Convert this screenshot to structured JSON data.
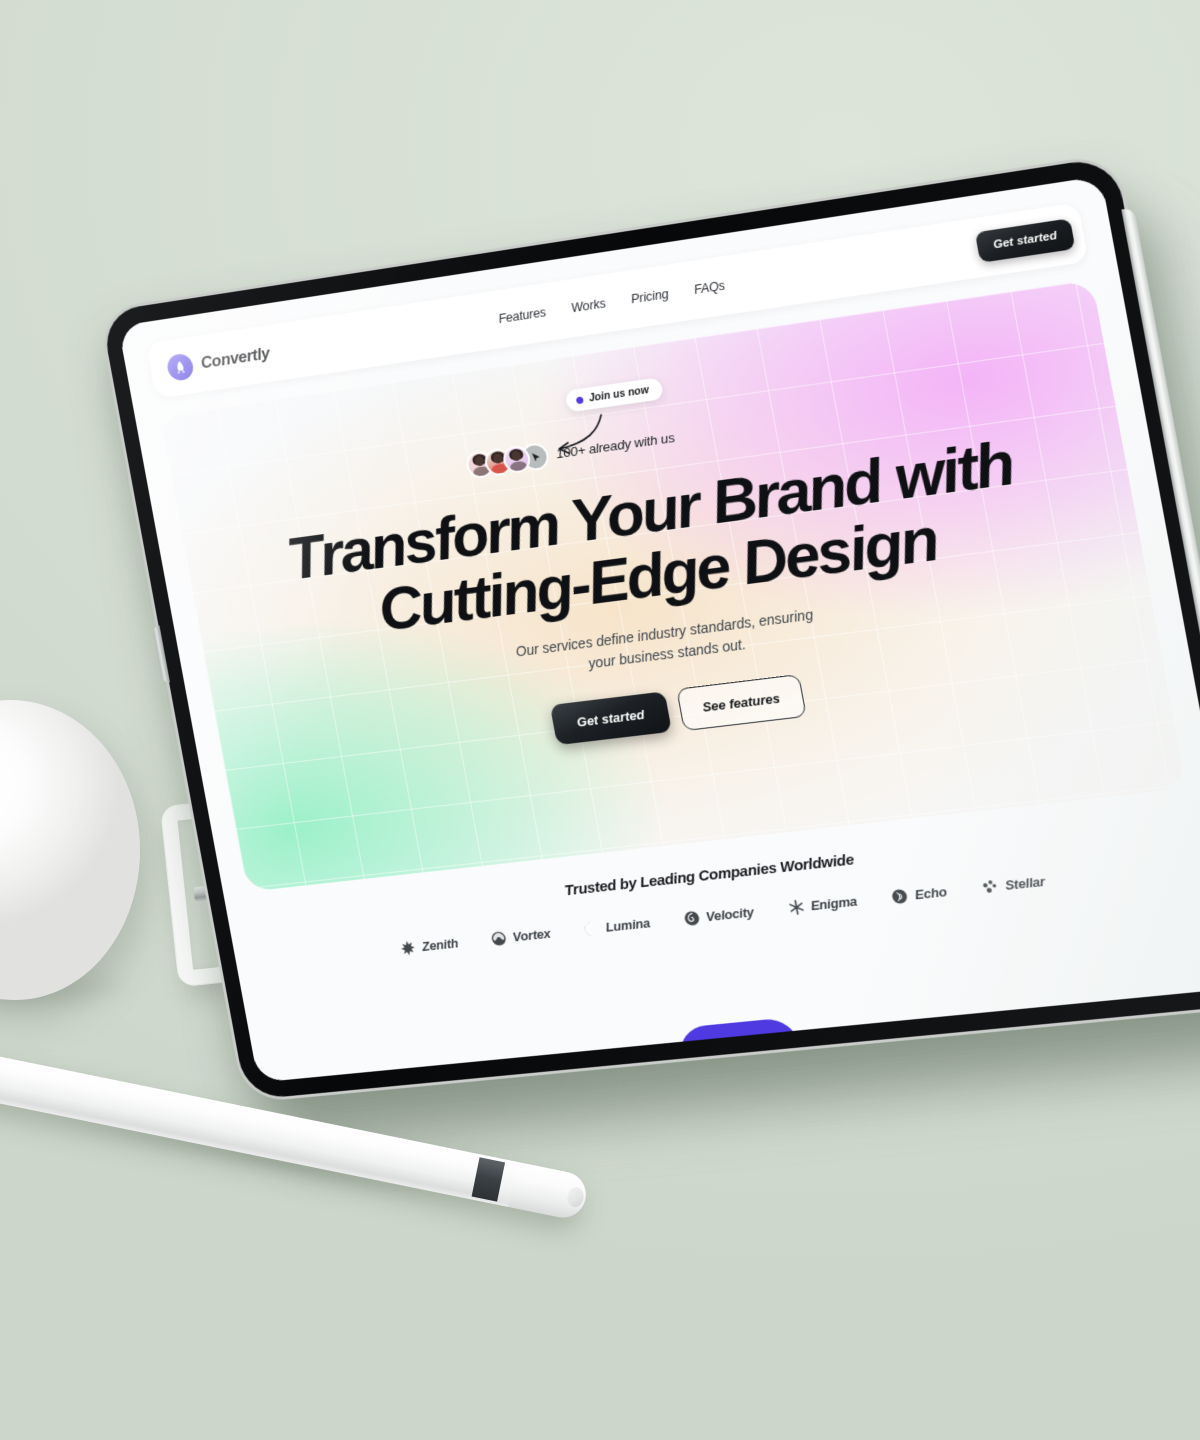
{
  "scene": {
    "background_color": "#d6dfd4",
    "device": "tablet",
    "objects": [
      "white-sphere-stand",
      "clamp-mount",
      "white-stylus"
    ]
  },
  "nav": {
    "brand_name": "Convertly",
    "brand_icon": "rocket-icon",
    "links": [
      {
        "label": "Features"
      },
      {
        "label": "Works"
      },
      {
        "label": "Pricing"
      },
      {
        "label": "FAQs"
      }
    ],
    "cta_label": "Get started"
  },
  "hero": {
    "badge": {
      "label": "Join us now",
      "dot_color": "#4f39e0"
    },
    "social_proof": {
      "text": "100+ already with us",
      "avatar_count": 3,
      "more_icon": "play-cursor-icon"
    },
    "headline_line1": "Transform Your Brand with",
    "headline_line2": "Cutting-Edge Design",
    "subhead": "Our services define industry standards, ensuring your business stands out.",
    "primary_cta": "Get started",
    "secondary_cta": "See features",
    "gradient": {
      "pink": "#f3b0f7",
      "mint": "#94f0c5",
      "cream": "#f7e2c6",
      "base": "#f7f8fa"
    }
  },
  "trusted": {
    "title": "Trusted by Leading Companies Worldwide",
    "logos": [
      {
        "label": "Zenith",
        "icon": "burst-star-icon"
      },
      {
        "label": "Vortex",
        "icon": "swirl-icon"
      },
      {
        "label": "Lumina",
        "icon": "crescent-icon"
      },
      {
        "label": "Velocity",
        "icon": "spiral-drop-icon"
      },
      {
        "label": "Enigma",
        "icon": "asterisk-icon"
      },
      {
        "label": "Echo",
        "icon": "sound-wave-icon"
      },
      {
        "label": "Stellar",
        "icon": "dots-cluster-icon"
      }
    ]
  },
  "next_section": {
    "peek_color": "#4f39e0"
  }
}
